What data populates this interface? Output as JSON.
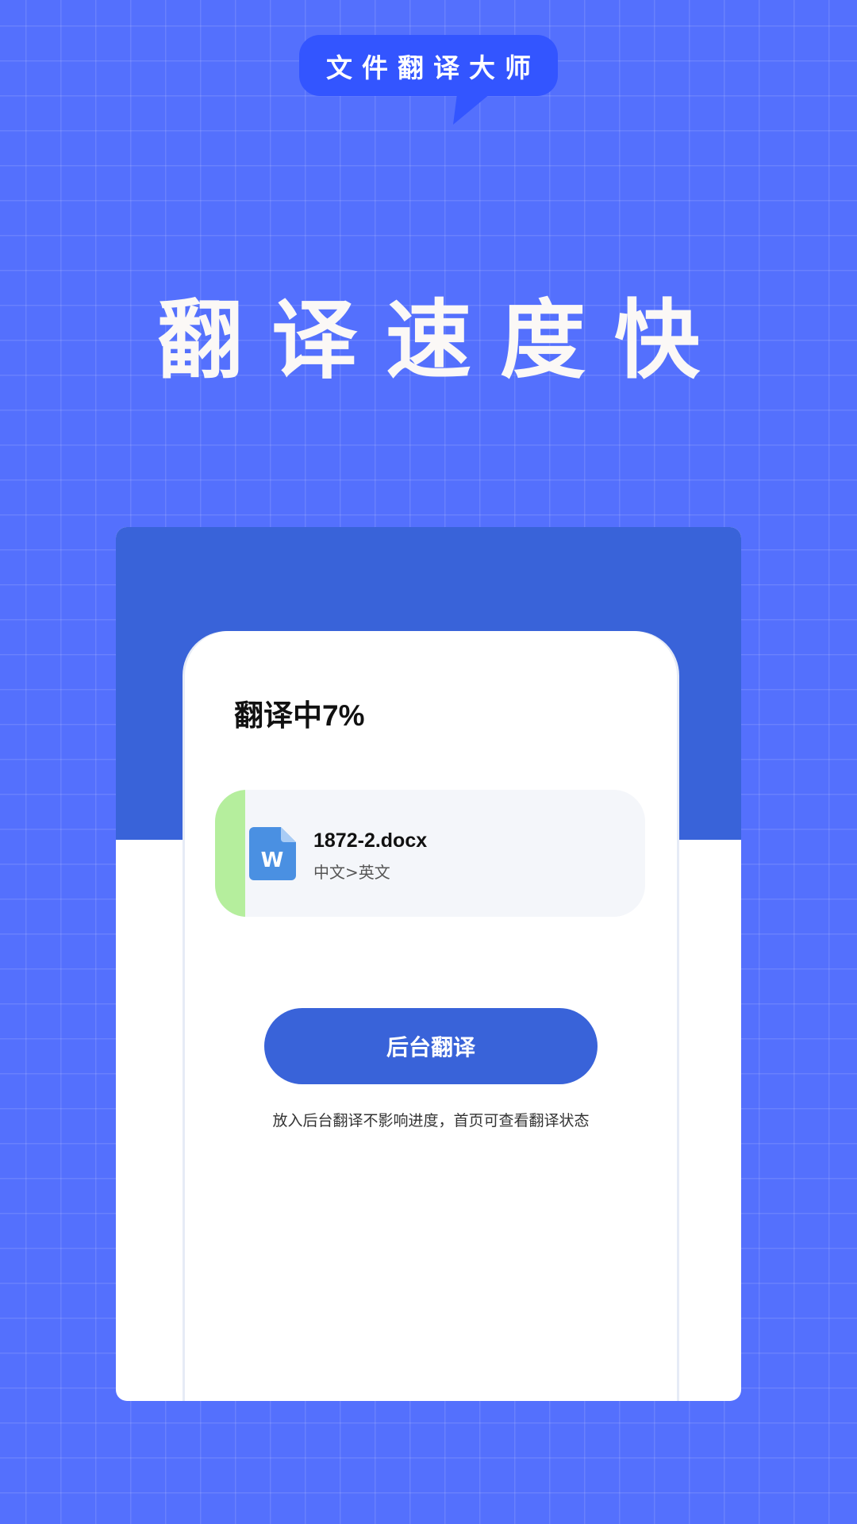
{
  "app": {
    "brand_label": "文件翻译大师"
  },
  "hero": {
    "headline": "翻译速度快"
  },
  "dialog": {
    "status_title": "翻译中7%",
    "progress_percent": 7,
    "file": {
      "icon": "word-document-icon",
      "icon_letter": "W",
      "name": "1872-2.docx",
      "language_pair": "中文>英文"
    },
    "background_button_label": "后台翻译",
    "hint_text": "放入后台翻译不影响进度，首页可查看翻译状态"
  },
  "colors": {
    "background": "#5470fd",
    "bubble": "#3355ff",
    "card_accent": "#3963d9",
    "progress": "#b5ee9d",
    "file_item_bg": "#f4f6fa",
    "word_icon": "#4a90e2"
  }
}
